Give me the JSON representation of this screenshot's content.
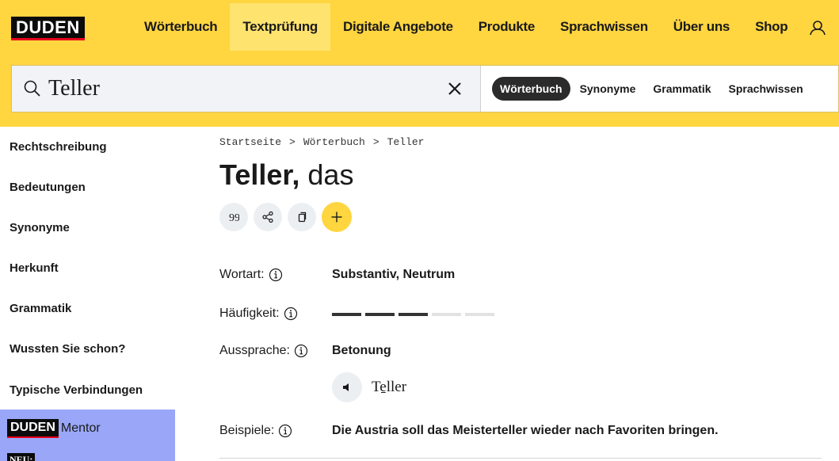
{
  "header": {
    "logo": "DUDEN",
    "nav": [
      "Wörterbuch",
      "Textprüfung",
      "Digitale Angebote",
      "Produkte",
      "Sprachwissen",
      "Über uns",
      "Shop"
    ],
    "active_nav": "Textprüfung",
    "brand_color": "#ffd540"
  },
  "search": {
    "value": "Teller",
    "scopes": [
      "Wörterbuch",
      "Synonyme",
      "Grammatik",
      "Sprachwissen"
    ],
    "active_scope": "Wörterbuch"
  },
  "sidebar": {
    "items": [
      "Rechtschreibung",
      "Bedeutungen",
      "Synonyme",
      "Herkunft",
      "Grammatik",
      "Wussten Sie schon?",
      "Typische Verbindungen"
    ],
    "mentor": {
      "logo": "DUDEN",
      "text": "Mentor",
      "badge": "NEU:",
      "bg_color": "#9aa7f8"
    }
  },
  "main": {
    "breadcrumb": [
      "Startseite",
      "Wörterbuch",
      "Teller"
    ],
    "title": {
      "word": "Teller,",
      "article": "das"
    },
    "actions": [
      "quote-icon",
      "share-icon",
      "copy-icon",
      "plus-icon"
    ],
    "rows": {
      "wortart": {
        "label": "Wortart:",
        "value": "Substantiv, Neutrum"
      },
      "haeufigkeit": {
        "label": "Häufigkeit:",
        "level": 3,
        "max": 5
      },
      "aussprache": {
        "label": "Aussprache:",
        "value": "Betonung",
        "phonetic": "Te̱ller"
      },
      "beispiele": {
        "label": "Beispiele:",
        "value": "Die Austria soll das Meisterteller wieder nach Favoriten bringen."
      }
    }
  }
}
